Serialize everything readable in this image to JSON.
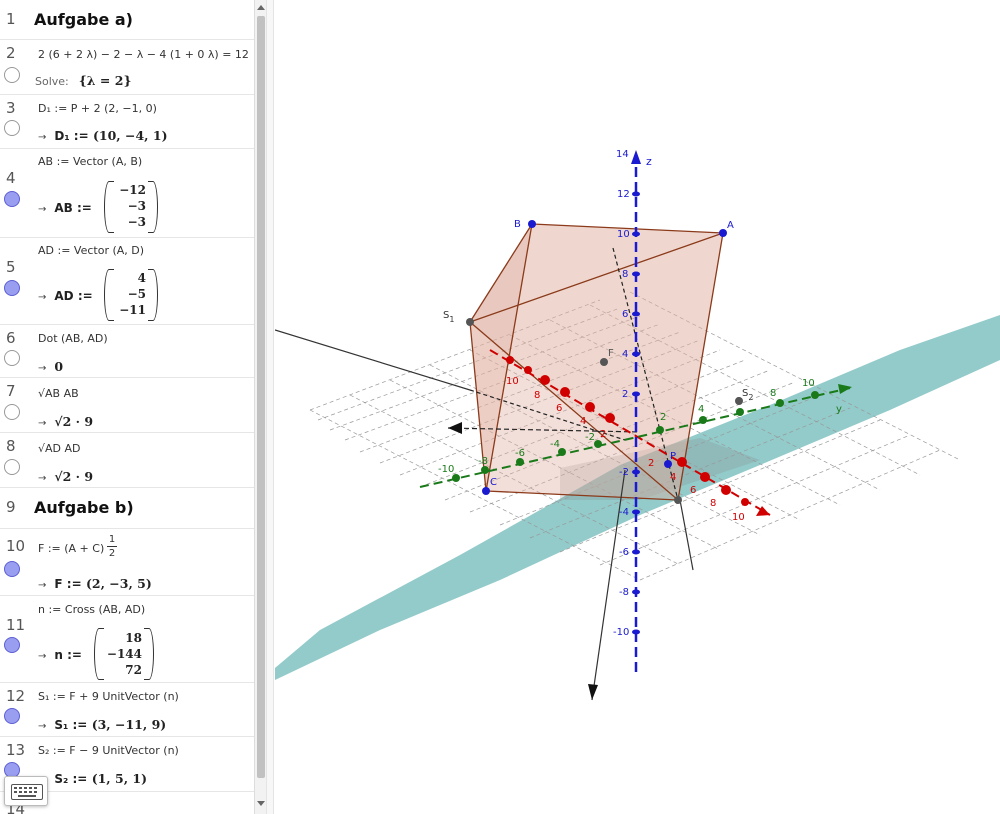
{
  "algebra": {
    "rows": [
      {
        "num": "1",
        "type": "heading",
        "text": "Aufgabe a)"
      },
      {
        "num": "2",
        "def": "2 (6 + 2 λ) − 2 − λ − 4 (1 + 0 λ) = 12",
        "solve_label": "Solve:",
        "result": "{λ = 2}"
      },
      {
        "num": "3",
        "def": "D₁ := P + 2 (2, −1, 0)",
        "result_name": "D₁ :=",
        "result": "(10, −4, 1)"
      },
      {
        "num": "4",
        "def": "AB := Vector (A, B)",
        "result_name": "AB :=",
        "vector": [
          "−12",
          "−3",
          "−3"
        ]
      },
      {
        "num": "5",
        "def": "AD := Vector (A, D)",
        "result_name": "AD :=",
        "vector": [
          "4",
          "−5",
          "−11"
        ]
      },
      {
        "num": "6",
        "def": "Dot (AB, AD)",
        "result": "0"
      },
      {
        "num": "7",
        "def": "√AB AB",
        "result": "√2 · 9"
      },
      {
        "num": "8",
        "def": "√AD AD",
        "result": "√2 · 9"
      },
      {
        "num": "9",
        "type": "heading",
        "text": "Aufgabe b)"
      },
      {
        "num": "10",
        "def_prefix": "F := (A + C)",
        "frac_num": "1",
        "frac_den": "2",
        "result_name": "F :=",
        "result": "(2, −3, 5)"
      },
      {
        "num": "11",
        "def": "n := Cross (AB, AD)",
        "result_name": "n :=",
        "vector": [
          "18",
          "−144",
          "72"
        ]
      },
      {
        "num": "12",
        "def": "S₁ := F + 9 UnitVector (n)",
        "result_name": "S₁ :=",
        "result": "(3, −11, 9)"
      },
      {
        "num": "13",
        "def": "S₂ := F − 9 UnitVector (n)",
        "result_name": "S₂ :=",
        "result": "(1, 5, 1)"
      },
      {
        "num": "14"
      }
    ],
    "arrow": "→"
  },
  "view3d": {
    "points": {
      "A": "A",
      "B": "B",
      "C": "C",
      "F": "F",
      "P": "P",
      "D": "D",
      "S1": "S",
      "S1_sub": "1",
      "S2": "S",
      "S2_sub": "2"
    },
    "z_ticks": [
      "14",
      "12",
      "10",
      "8",
      "6",
      "4",
      "2",
      "-2",
      "-4",
      "-6",
      "-8",
      "-10"
    ],
    "z_label": "z",
    "y_label": "y",
    "x_ticks": [
      "10",
      "8",
      "6",
      "4",
      "2",
      "2",
      "4",
      "6",
      "8",
      "10"
    ],
    "y_ticks": [
      "-10",
      "-8",
      "-6",
      "-4",
      "-2",
      "2",
      "4",
      "6",
      "8",
      "10"
    ],
    "colors": {
      "x_axis": "#d00000",
      "y_axis": "#1a7a1a",
      "z_axis": "#1a1ad0",
      "plane": "#6fb8b8",
      "cube_face": "#e0b0a0",
      "cube_edge": "#8b3a1a",
      "point": "#1a1ad0"
    }
  },
  "icons": {
    "keyboard": "keyboard-icon"
  }
}
